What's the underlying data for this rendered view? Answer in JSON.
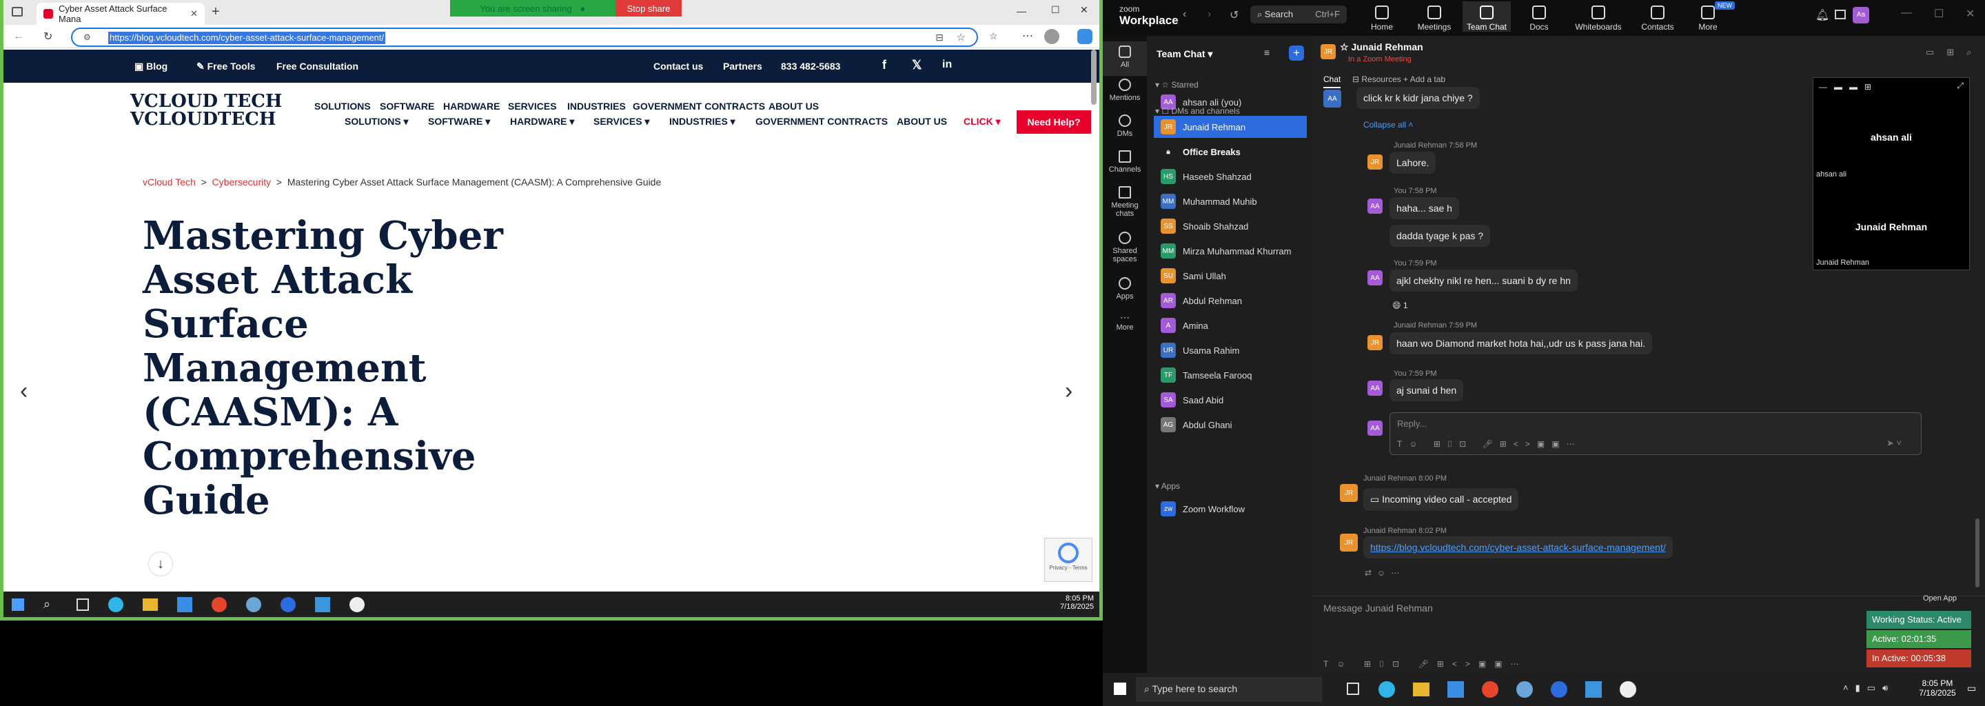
{
  "browser": {
    "tab_title": "Cyber Asset Attack Surface Mana",
    "new_tab": "+",
    "share_label": "You are screen sharing",
    "stop_share": "Stop share",
    "url": "https://blog.vcloudtech.com/cyber-asset-attack-surface-management/"
  },
  "site": {
    "nav_blog": "Blog",
    "nav_tools": "Free Tools",
    "nav_consult": "Free Consultation",
    "nav_contact": "Contact us",
    "nav_partners": "Partners",
    "phone": "833 482-5683",
    "logo_line1": "VCLOUD TECH",
    "logo_line2": "VCLOUDTECH",
    "menu_top": [
      "SOLUTIONS",
      "SOFTWARE",
      "HARDWARE",
      "SERVICES",
      "INDUSTRIES",
      "GOVERNMENT CONTRACTS",
      "ABOUT US"
    ],
    "menu_main": [
      "SOLUTIONS",
      "SOFTWARE",
      "HARDWARE",
      "SERVICES",
      "INDUSTRIES",
      "GOVERNMENT CONTRACTS",
      "ABOUT US",
      "CLICK"
    ],
    "need_help": "Need Help?",
    "crumb_home": "vCloud Tech",
    "crumb_sep": ">",
    "crumb_cat": "Cybersecurity",
    "crumb_current": "Mastering Cyber Asset Attack Surface Management (CAASM): A Comprehensive Guide",
    "hero_title": "Mastering Cyber Asset Attack Surface Management (CAASM): A Comprehensive Guide",
    "recaptcha": "Privacy - Terms"
  },
  "taskbar_left": {
    "time": "8:05 PM",
    "date": "7/18/2025"
  },
  "zoom": {
    "brand_top": "zoom",
    "brand_bottom": "Workplace",
    "search": "Search",
    "search_shortcut": "Ctrl+F",
    "tabs": [
      "Home",
      "Meetings",
      "Team Chat",
      "Docs",
      "Whiteboards",
      "Contacts",
      "More"
    ],
    "new_badge": "NEW",
    "sidebar": [
      "All",
      "Mentions",
      "DMs",
      "Channels",
      "Meeting chats",
      "Shared spaces",
      "Apps",
      "More"
    ],
    "list_title": "Team Chat",
    "starred": "Starred",
    "starred_user": "ahsan ali (you)",
    "dms_section": "DMs and channels",
    "contacts": [
      "Junaid Rehman",
      "Office Breaks",
      "Haseeb Shahzad",
      "Muhammad Muhib",
      "Shoaib Shahzad",
      "Mirza Muhammad Khurram",
      "Sami Ullah",
      "Abdul Rehman",
      "Amina",
      "Usama Rahim",
      "Tamseela Farooq",
      "Saad Abid",
      "Abdul Ghani"
    ],
    "contact_initials": [
      "JR",
      "",
      "HS",
      "MM",
      "SS",
      "MM",
      "SU",
      "AR",
      "A",
      "UR",
      "TF",
      "SA",
      "AG"
    ],
    "apps_section": "Apps",
    "zoom_workflow": "Zoom Workflow",
    "chat_name": "Junaid Rehman",
    "chat_status": "In a Zoom Meeting",
    "chat_tab": "Chat",
    "resources_tab": "Resources",
    "add_tab": "Add a tab",
    "messages": {
      "m0": "click kr k kidr jana chiye ?",
      "collapse": "Collapse all",
      "h1": "Junaid Rehman 7:58 PM",
      "m1": "Lahore.",
      "h2": "You 7:58 PM",
      "m2": "haha... sae h",
      "m3": "dadda tyage k pas ?",
      "h3": "You 7:59 PM",
      "m4": "ajkl chekhy nikl re hen... suani b dy re hn",
      "reaction": "1",
      "h4": "Junaid Rehman 7:59 PM",
      "m5": "haan wo Diamond market hota hai,,udr us k pass jana hai.",
      "h5": "You 7:59 PM",
      "m6": "aj sunai d hen",
      "reply_placeholder": "Reply...",
      "h6": "Junaid Rehman 8:00 PM",
      "m7": "Incoming video call - accepted",
      "h7": "Junaid Rehman 8:02 PM",
      "m8": "https://blog.vcloudtech.com/cyber-asset-attack-surface-management/"
    },
    "compose_placeholder": "Message Junaid Rehman",
    "video_name_1": "ahsan ali",
    "video_name_2": "Junaid Rehman",
    "open_app": "Open App",
    "working_status": "Working Status: Active",
    "active_time": "Active: 02:01:35",
    "inactive_time": "In Active: 00:05:38"
  },
  "taskbar_right": {
    "search": "Type here to search",
    "time": "8:05 PM",
    "date": "7/18/2025"
  }
}
